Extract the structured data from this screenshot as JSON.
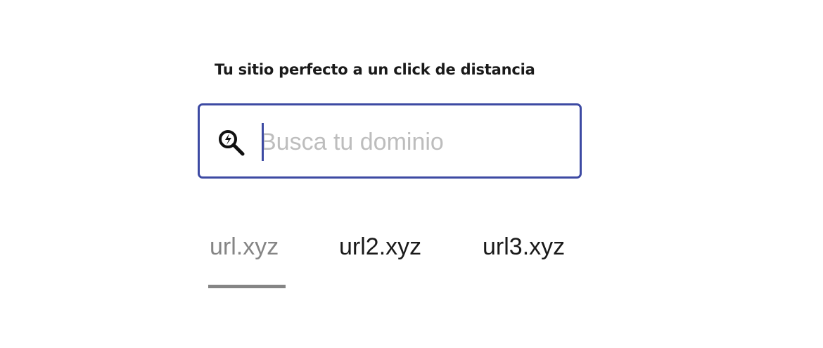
{
  "headline": "Tu sitio perfecto a un click de distancia",
  "search": {
    "placeholder": "Busca tu dominio",
    "value": "",
    "icon": "search-magnifier-icon"
  },
  "tabs": [
    {
      "label": "url.xyz",
      "active": true
    },
    {
      "label": "url2.xyz",
      "active": false
    },
    {
      "label": "url3.xyz",
      "active": false
    }
  ],
  "colors": {
    "accent": "#3d4aa3",
    "active_tab": "#858585",
    "inactive_tab": "#1a1a1a",
    "placeholder": "#bdbdbd"
  }
}
